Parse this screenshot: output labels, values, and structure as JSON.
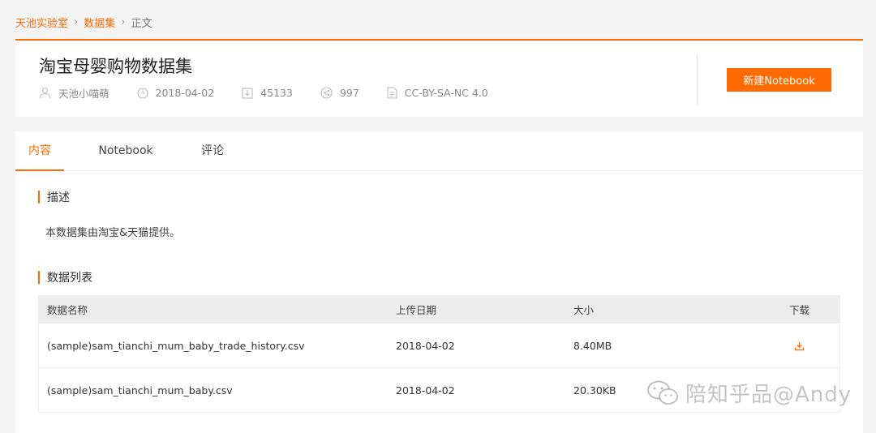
{
  "breadcrumb": {
    "items": [
      "天池实验室",
      "数据集"
    ],
    "separator": "›",
    "current": "正文"
  },
  "dataset": {
    "title": "淘宝母婴购物数据集",
    "author": "天池小喵萌",
    "date": "2018-04-02",
    "downloads": "45133",
    "shares": "997",
    "license": "CC-BY-SA-NC 4.0"
  },
  "new_notebook_label": "新建Notebook",
  "tabs": [
    {
      "label": "内容",
      "active": true
    },
    {
      "label": "Notebook",
      "active": false
    },
    {
      "label": "评论",
      "active": false
    }
  ],
  "description": {
    "heading": "描述",
    "text": "本数据集由淘宝&天猫提供。"
  },
  "file_list": {
    "heading": "数据列表",
    "columns": [
      "数据名称",
      "上传日期",
      "大小",
      "下载"
    ],
    "rows": [
      {
        "name": "(sample)sam_tianchi_mum_baby_trade_history.csv",
        "date": "2018-04-02",
        "size": "8.40MB"
      },
      {
        "name": "(sample)sam_tianchi_mum_baby.csv",
        "date": "2018-04-02",
        "size": "20.30KB"
      }
    ]
  },
  "watermark": "陪知乎品@Andy",
  "colors": {
    "accent": "#ff6a00",
    "background": "#f4f4f5"
  },
  "icons": [
    "user-icon",
    "clock-icon",
    "download-icon",
    "share-icon",
    "license-icon",
    "wechat-icon"
  ]
}
